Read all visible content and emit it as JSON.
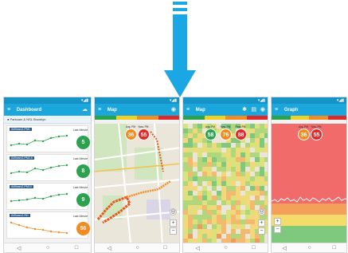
{
  "colors": {
    "arrow": "#1aa7e4",
    "statusbar": "#1593c7",
    "appbar": "#1ba6dc",
    "green": "#2ca24e",
    "orange": "#f28c22",
    "red": "#e02a2a",
    "graph_red": "#f26b6b"
  },
  "dashboard": {
    "title": "Dashboard",
    "location": "Parkcam & NSL Brooklyn",
    "cards": [
      {
        "name": "AirBeam2-PM1",
        "last_label": "Last Minute",
        "value": "5",
        "color": "#2ca24e"
      },
      {
        "name": "AirBeam2-PM2.5",
        "last_label": "Last Minute",
        "value": "8",
        "color": "#2ca24e"
      },
      {
        "name": "AirBeam2-PM10",
        "last_label": "Last Minute",
        "value": "9",
        "color": "#2ca24e"
      },
      {
        "name": "AirBeam2-RH",
        "last_label": "Last Minute",
        "value": "56",
        "color": "#f28c22"
      }
    ]
  },
  "map": {
    "title": "Map",
    "avg_label": "Avg. PM",
    "now_label": "Now. PM",
    "avg_value": "36",
    "now_value": "55"
  },
  "heatmap": {
    "title": "Map",
    "avg_label": "Avg. PM",
    "now_label": "Now. PM",
    "peak_label": "Peak PM",
    "avg_value": "58",
    "now_value": "76",
    "peak_value": "88"
  },
  "graph": {
    "title": "Graph",
    "avg_label": "Avg. PM",
    "now_label": "Now. PM",
    "avg_value": "36",
    "now_value": "55"
  },
  "icons": [
    "down-arrow-icon",
    "menu-icon",
    "back-icon",
    "home-icon",
    "recents-icon",
    "plus-icon",
    "minus-icon",
    "locate-icon"
  ]
}
